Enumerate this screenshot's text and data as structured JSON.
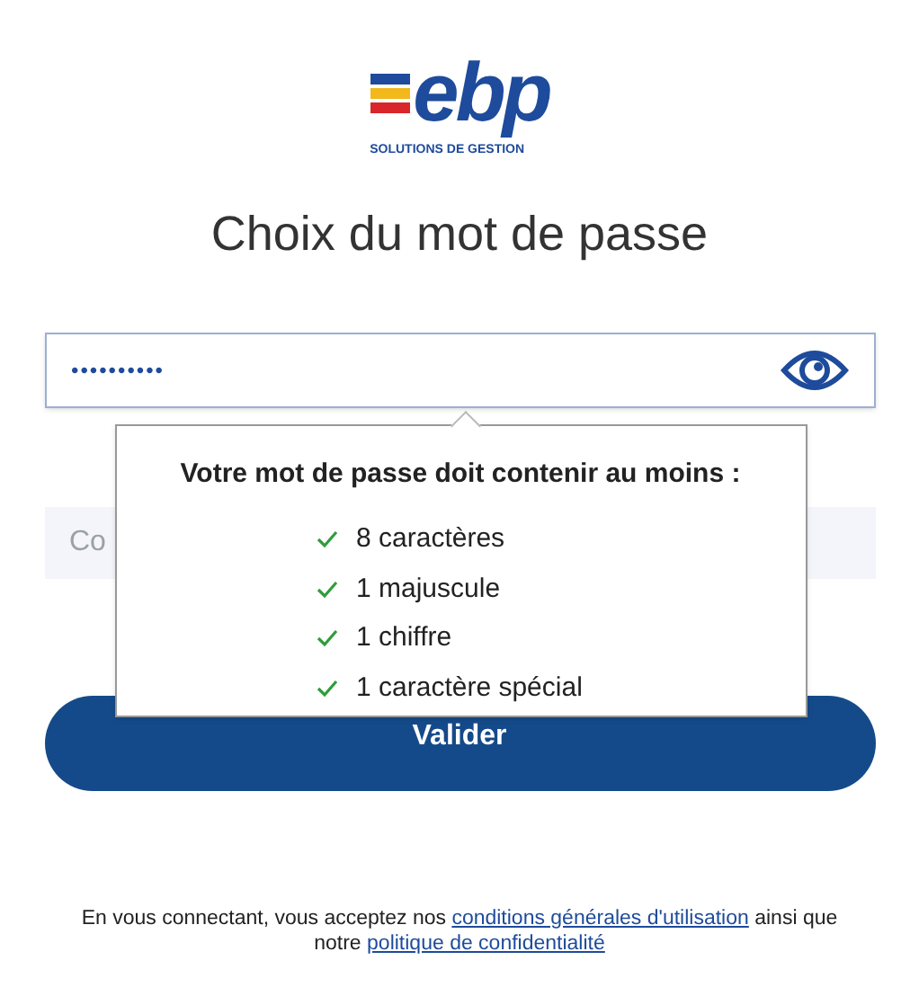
{
  "logo": {
    "wordmark": "ebp",
    "tagline": "SOLUTIONS DE GESTION"
  },
  "title": "Choix du mot de passe",
  "password_field": {
    "value": "••••••••••"
  },
  "confirm_field": {
    "placeholder": "Co"
  },
  "requirements_popover": {
    "heading": "Votre mot de passe doit contenir au moins :",
    "items": [
      {
        "label": "8 caractères",
        "met": true
      },
      {
        "label": "1 majuscule",
        "met": true
      },
      {
        "label": "1 chiffre",
        "met": true
      },
      {
        "label": "1 caractère spécial",
        "met": true
      }
    ]
  },
  "submit_button": "Valider",
  "footer": {
    "before": "En vous connectant, vous acceptez nos",
    "link_1": "conditions générales d'utilisation",
    "middle": "ainsi que notre",
    "link_2": "politique de confidentialité"
  }
}
